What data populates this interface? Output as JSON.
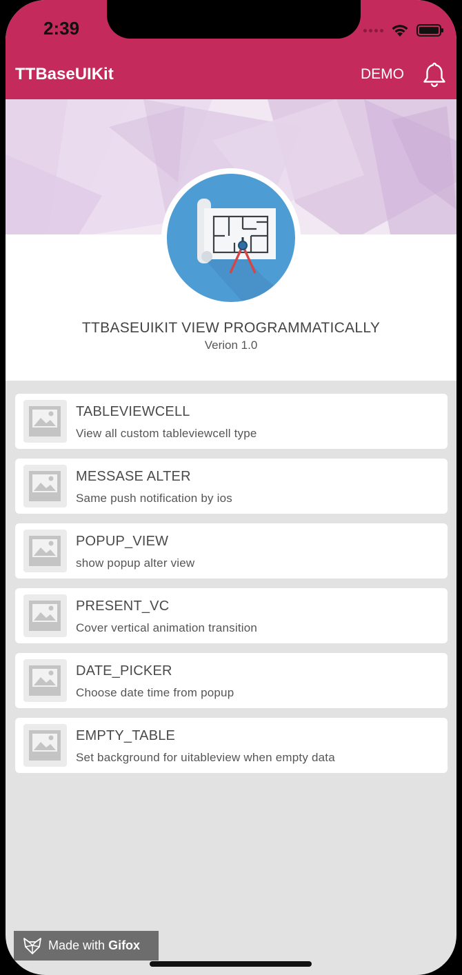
{
  "status_bar": {
    "time": "2:39"
  },
  "nav": {
    "title": "TTBaseUIKit",
    "demo_label": "DEMO"
  },
  "header": {
    "title": "TTBASEUIKIT VIEW PROGRAMMATICALLY",
    "subtitle": "Verion 1.0"
  },
  "items": [
    {
      "title": "TABLEVIEWCELL",
      "subtitle": "View all custom tableviewcell type"
    },
    {
      "title": "MESSASE ALTER",
      "subtitle": "Same push notification by ios"
    },
    {
      "title": "POPUP_VIEW",
      "subtitle": "show popup alter view"
    },
    {
      "title": "PRESENT_VC",
      "subtitle": "Cover vertical animation transition"
    },
    {
      "title": "DATE_PICKER",
      "subtitle": "Choose date time from popup"
    },
    {
      "title": "EMPTY_TABLE",
      "subtitle": "Set background for uitableview when empty data"
    }
  ],
  "watermark": {
    "prefix": "Made with",
    "brand": "Gifox"
  },
  "colors": {
    "nav_bar": "#c42a5c",
    "background": "#e2e2e2",
    "logo_circle": "#4d9cd4"
  },
  "icons": [
    "wifi-icon",
    "battery-icon",
    "bell-icon",
    "blueprint-logo",
    "image-placeholder-icon",
    "gifox-fox-icon"
  ]
}
